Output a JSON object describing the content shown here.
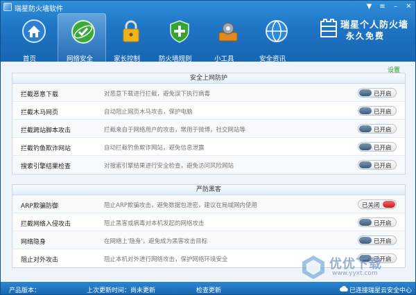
{
  "window": {
    "title": "瑞星防火墙软件"
  },
  "brand": {
    "line1": "瑞星个人防火墙",
    "line2": "永久免费"
  },
  "nav": [
    {
      "label": "首页",
      "icon": "home-icon"
    },
    {
      "label": "网络安全",
      "icon": "network-security-icon",
      "active": true
    },
    {
      "label": "家长控制",
      "icon": "lock-icon"
    },
    {
      "label": "防火墙规则",
      "icon": "shield-icon"
    },
    {
      "label": "小工具",
      "icon": "gear-toolbox-icon"
    },
    {
      "label": "安全资讯",
      "icon": "globe-icon"
    }
  ],
  "settings_link": "设置",
  "section1": {
    "title": "安全上网防护",
    "rows": [
      {
        "name": "拦截恶意下载",
        "desc": "对恶意下载进行拦截，避免误下执行病毒",
        "state": "已开启"
      },
      {
        "name": "拦截木马网页",
        "desc": "自动阻止网页木马攻击，保护电脑",
        "state": "已开启"
      },
      {
        "name": "拦截跨站脚本攻击",
        "desc": "拦截来自于网络用户的攻击，常用于微博，社交网站等",
        "state": "已开启"
      },
      {
        "name": "拦截钓鱼欺诈网站",
        "desc": "自动拦截钓鱼欺诈网站，避免信息泄露",
        "state": "已开启"
      },
      {
        "name": "搜索引擎结果检查",
        "desc": "对搜索引擎结果进行安全检查，避免访问风险网站",
        "state": "已开启"
      }
    ]
  },
  "section2": {
    "title": "严防黑客",
    "rows": [
      {
        "name": "ARP欺骗防御",
        "desc": "阻止ARP欺骗攻击，避免数据包泄密，建议在局域网内使用",
        "state": "已关闭"
      },
      {
        "name": "拦截网络入侵攻击",
        "desc": "阻止黑客或病毒对本机发起的网络攻击",
        "state": "已开启"
      },
      {
        "name": "网络隐身",
        "desc": "在网络上'隐身'，避免成为黑客攻击目标",
        "state": "已开启"
      },
      {
        "name": "阻止对外攻击",
        "desc": "阻止本机对外进行网络攻击，保护网络环境安全",
        "state": "已开启"
      }
    ]
  },
  "footer": {
    "version": "产品版本：",
    "last_update": "上次更新时间：尚未更新",
    "check_update": "检查更新",
    "cloud_status": "已连接瑞星云安全中心"
  },
  "watermark": {
    "text": "优优下载",
    "url": "www.yyxt.com"
  }
}
